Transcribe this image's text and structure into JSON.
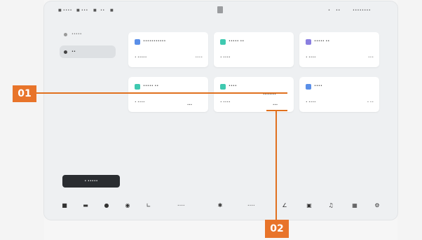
{
  "statusbar": {
    "left": [
      "■ ••••",
      "■ •••",
      "■",
      "••",
      "■"
    ],
    "right": [
      "•",
      "••",
      "••••••••"
    ]
  },
  "nav": {
    "items": [
      {
        "label": "•••••",
        "active": false
      },
      {
        "label": "••",
        "active": true
      }
    ]
  },
  "cards": [
    {
      "title": "•••••••••••",
      "label": "• •••••",
      "value": "••••",
      "icon_color": "#5a8fe8"
    },
    {
      "title": "••••• ••",
      "label": "• ••••",
      "value": "",
      "icon_color": "#3fc9b0"
    },
    {
      "title": "••••• ••",
      "label": "• ••••",
      "value": "•••",
      "icon_color": "#8a7fe0"
    },
    {
      "title": "••••• ••",
      "label": "• ••••",
      "value": "•••",
      "icon_color": "#3fc9b0"
    },
    {
      "title": "••••",
      "label": "• ••••",
      "value": "•••",
      "icon_color": "#3fc9b0"
    },
    {
      "title": "••••",
      "label": "• ••••",
      "value": "• ••",
      "icon_color": "#5a8fe8"
    }
  ],
  "card_mini_labels": {
    "card4": "•••",
    "card5_top": "••••••••",
    "card5_bottom": "•••"
  },
  "start_button": {
    "label": "• •••••"
  },
  "dock": {
    "text_1": "••••",
    "text_2": "••••"
  },
  "callouts": [
    {
      "label": "01"
    },
    {
      "label": "02"
    }
  ],
  "colors": {
    "accent": "#e8742a",
    "line": "#e0701e",
    "dark_button": "#2a2d31"
  }
}
